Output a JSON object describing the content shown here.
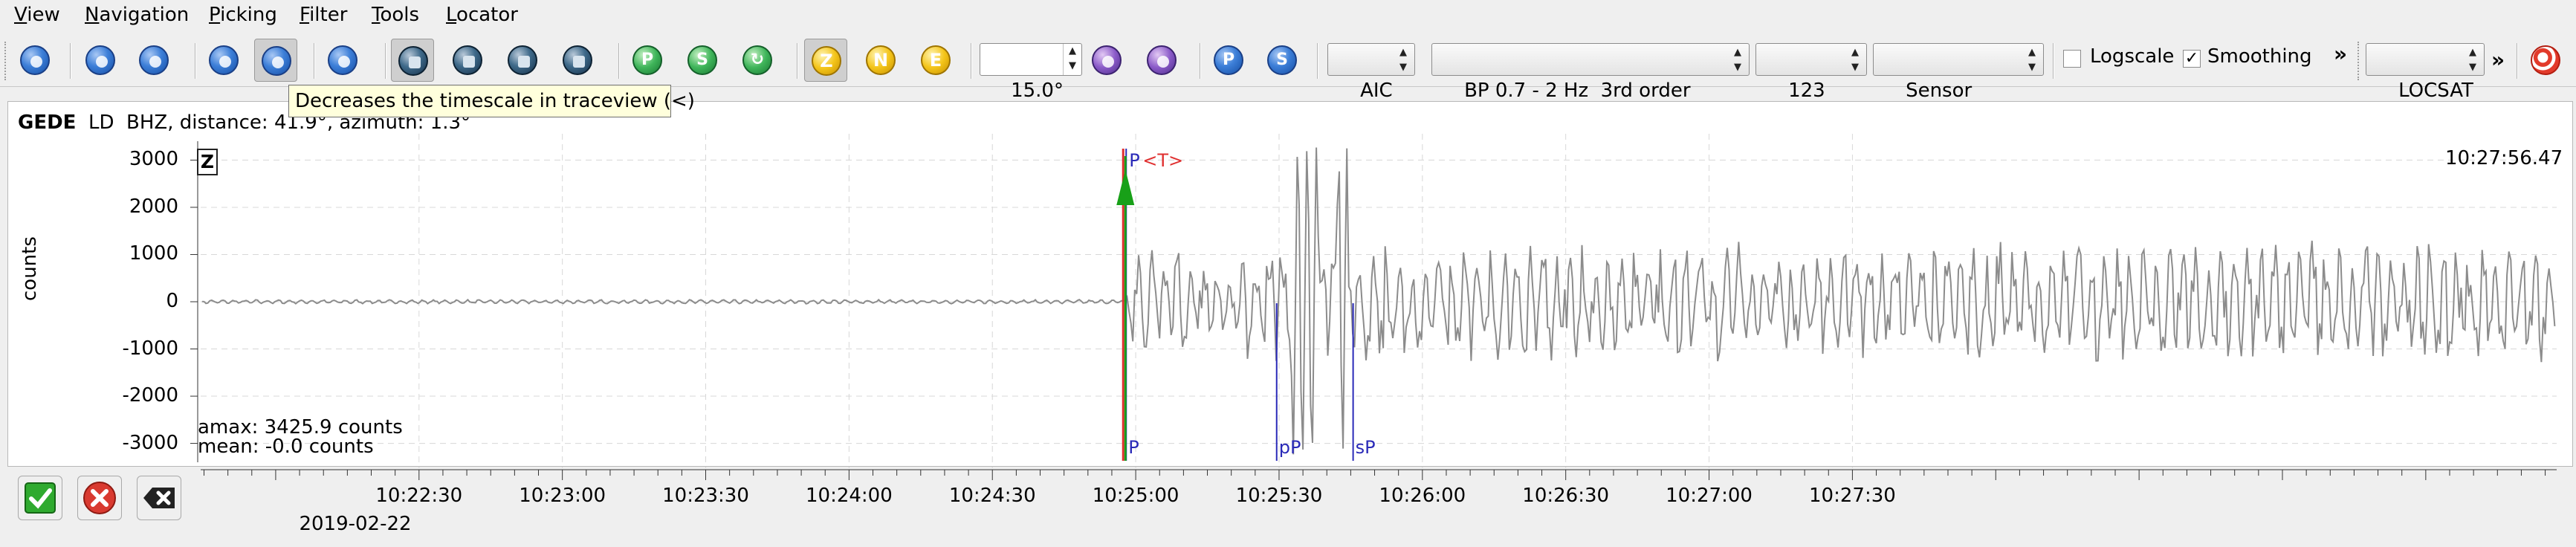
{
  "menu": [
    {
      "label": "View",
      "mnemonic": "V"
    },
    {
      "label": "Navigation",
      "mnemonic": "N"
    },
    {
      "label": "Picking",
      "mnemonic": "P"
    },
    {
      "label": "Filter",
      "mnemonic": "F"
    },
    {
      "label": "Tools",
      "mnemonic": "T"
    },
    {
      "label": "Locator",
      "mnemonic": "L"
    }
  ],
  "toolbar": {
    "buttons": [
      {
        "name": "home-icon",
        "style": "blue"
      },
      {
        "name": "scroll-up-icon",
        "style": "blue"
      },
      {
        "name": "scroll-down-icon",
        "style": "blue"
      },
      {
        "name": "previous-icon",
        "style": "blue"
      },
      {
        "name": "decrease-timescale-icon",
        "style": "blue"
      },
      {
        "name": "align-icon",
        "style": "blue"
      },
      {
        "name": "pick-tool-icon",
        "style": "dark"
      },
      {
        "name": "measure-tool-icon",
        "style": "dark"
      },
      {
        "name": "spectrogram-icon",
        "style": "dark"
      },
      {
        "name": "spectrum-icon",
        "style": "dark"
      },
      {
        "name": "p-arrival-icon",
        "style": "green",
        "glyph": "P"
      },
      {
        "name": "s-arrival-icon",
        "style": "green",
        "glyph": "S"
      },
      {
        "name": "refresh-icon",
        "style": "green",
        "glyph": "↻"
      },
      {
        "name": "component-z-icon",
        "style": "yellow",
        "glyph": "Z"
      },
      {
        "name": "component-n-icon",
        "style": "yellow",
        "glyph": "N"
      },
      {
        "name": "component-e-icon",
        "style": "yellow",
        "glyph": "E"
      },
      {
        "name": "rotate-left-icon",
        "style": "violet"
      },
      {
        "name": "rotate-right-icon",
        "style": "violet"
      },
      {
        "name": "pick-p-icon",
        "style": "blue",
        "glyph": "P"
      },
      {
        "name": "pick-s-icon",
        "style": "blue",
        "glyph": "S"
      },
      {
        "name": "target-icon",
        "style": "red"
      }
    ],
    "angle_value": "15.0°",
    "picker_select": "AIC",
    "filter_select": "BP 0.7 - 2 Hz  3rd order",
    "rotation_select": "123",
    "unit_select": "Sensor",
    "logscale_label": "Logscale",
    "logscale_checked": false,
    "smoothing_label": "Smoothing",
    "smoothing_checked": true,
    "overflow_glyph": "»",
    "locator_select": "LOCSAT"
  },
  "tooltip": "Decreases the timescale in traceview (<)",
  "trace": {
    "station": "GEDE",
    "network": "LD",
    "channel": "BHZ, distance: 41.9°, azimuth: 1.3°",
    "component_badge": "Z",
    "end_time": "10:27:56.47",
    "y_axis_label": "counts",
    "amax": "amax: 3425.9 counts",
    "mean": "mean: -0.0 counts",
    "phase_label_top": "P",
    "theoretical_label": "<T>",
    "phase_markers": [
      "P",
      "pP",
      "sP"
    ],
    "colors": {
      "trace": "#8c8c8c",
      "phase": "#2a2ab8",
      "pick": "#18a018",
      "theoretical": "#e03030"
    }
  },
  "chart_data": {
    "type": "line",
    "title": "",
    "xlabel": "",
    "ylabel": "counts",
    "yticks": [
      3000,
      2000,
      1000,
      0,
      -1000,
      -2000,
      -3000
    ],
    "ylim": [
      -3400,
      3400
    ],
    "xtick_labels": [
      "10:22:30",
      "10:23:00",
      "10:23:30",
      "10:24:00",
      "10:24:30",
      "10:25:00",
      "10:25:30",
      "10:26:00",
      "10:26:30",
      "10:27:00",
      "10:27:30"
    ],
    "xlim_seconds_from_1022": [
      -15.7,
      477.4
    ],
    "date_label": "2019-02-22",
    "grid": true,
    "phases": [
      {
        "name": "P",
        "time": "10:24:58.0"
      },
      {
        "name": "pP",
        "time": "10:25:29.5"
      },
      {
        "name": "sP",
        "time": "10:25:45.5"
      }
    ],
    "series": [
      {
        "noise_before_p": 50,
        "amplitude_after_p_typical": 900,
        "amax": 3425.9
      }
    ]
  },
  "bottom_buttons": [
    {
      "name": "accept-button",
      "glyph": "✔"
    },
    {
      "name": "reject-button",
      "glyph": "✖"
    },
    {
      "name": "close-button",
      "glyph": "⇥"
    }
  ]
}
